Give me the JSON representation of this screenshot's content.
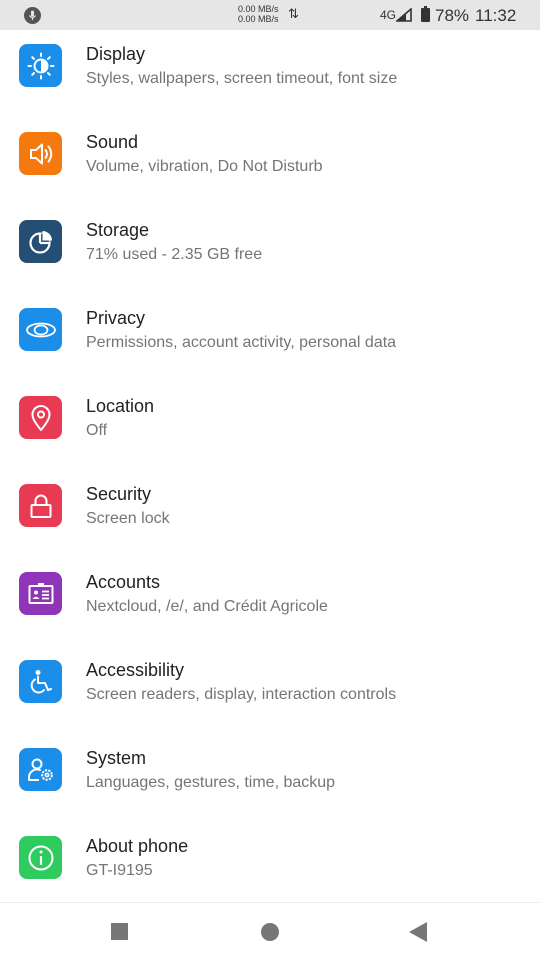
{
  "status_bar": {
    "net_up": "0.00 MB/s",
    "net_down": "0.00 MB/s",
    "network_type": "4G",
    "battery_percent": "78%",
    "time": "11:32"
  },
  "settings": [
    {
      "title": "Display",
      "subtitle": "Styles, wallpapers, screen timeout, font size",
      "icon": "display-icon",
      "color": "#1a8ee9"
    },
    {
      "title": "Sound",
      "subtitle": "Volume, vibration, Do Not Disturb",
      "icon": "sound-icon",
      "color": "#f5790f"
    },
    {
      "title": "Storage",
      "subtitle": "71% used - 2.35 GB free",
      "icon": "storage-icon",
      "color": "#244e73"
    },
    {
      "title": "Privacy",
      "subtitle": "Permissions, account activity, personal data",
      "icon": "privacy-icon",
      "color": "#1a8ee9"
    },
    {
      "title": "Location",
      "subtitle": "Off",
      "icon": "location-icon",
      "color": "#e83b53"
    },
    {
      "title": "Security",
      "subtitle": "Screen lock",
      "icon": "lock-icon",
      "color": "#e83b53"
    },
    {
      "title": "Accounts",
      "subtitle": "Nextcloud, /e/, and Crédit Agricole",
      "icon": "accounts-icon",
      "color": "#8f35b8"
    },
    {
      "title": "Accessibility",
      "subtitle": "Screen readers, display, interaction controls",
      "icon": "accessibility-icon",
      "color": "#1a8ee9"
    },
    {
      "title": "System",
      "subtitle": "Languages, gestures, time, backup",
      "icon": "system-icon",
      "color": "#1a8ee9"
    },
    {
      "title": "About phone",
      "subtitle": "GT-I9195",
      "icon": "info-icon",
      "color": "#2ecc5f"
    }
  ]
}
